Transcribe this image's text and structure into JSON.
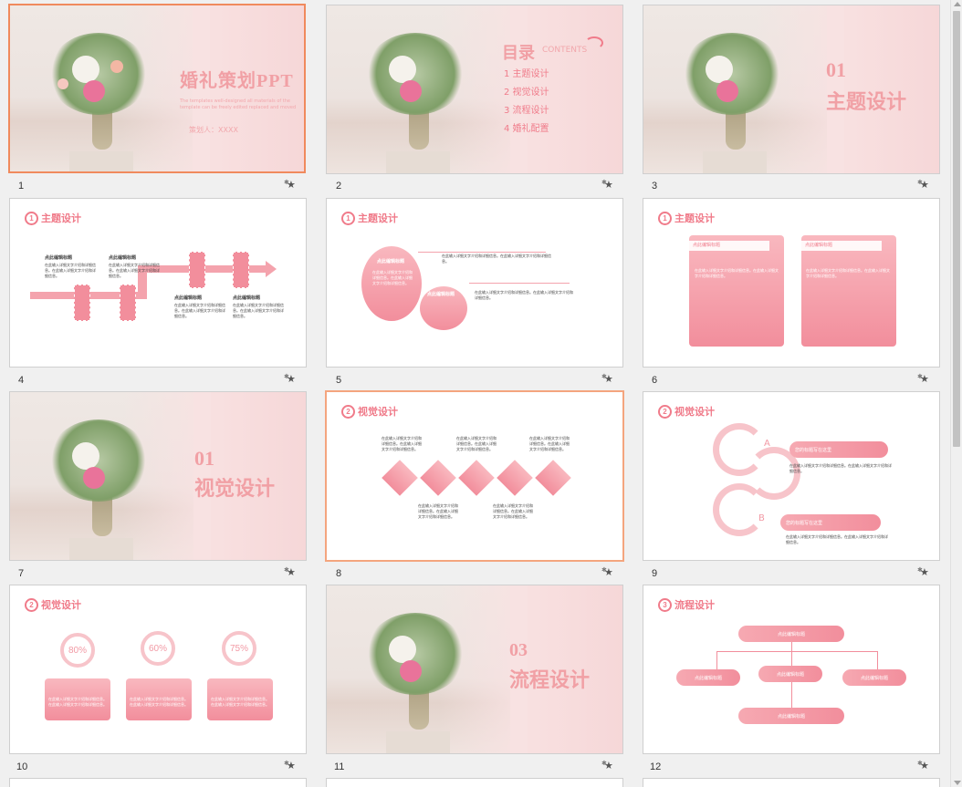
{
  "slides": [
    {
      "num": "1",
      "title": "婚礼策划PPT",
      "subtitle": "The templates well-designed all materials of the template can be freely edited replaced and moved",
      "planner": "策划人：XXXX"
    },
    {
      "num": "2",
      "heading": "目录",
      "heading_en": "CONTENTS",
      "items": [
        "1 主题设计",
        "2 视觉设计",
        "3 流程设计",
        "4 婚礼配置"
      ]
    },
    {
      "num": "3",
      "num_label": "01",
      "title": "主题设计"
    },
    {
      "num": "4",
      "section": "主题设计",
      "labels": [
        "点此编辑标题",
        "点此编辑标题",
        "点此编辑标题",
        "点此编辑标题"
      ]
    },
    {
      "num": "5",
      "section": "主题设计",
      "labels": [
        "点此编辑标题",
        "点此编辑标题"
      ]
    },
    {
      "num": "6",
      "section": "主题设计",
      "labels": [
        "点此编辑标题",
        "点此编辑标题"
      ]
    },
    {
      "num": "7",
      "num_label": "01",
      "title": "视觉设计"
    },
    {
      "num": "8",
      "section": "视觉设计"
    },
    {
      "num": "9",
      "section": "视觉设计",
      "letters": [
        "A",
        "B"
      ],
      "labels": [
        "您的标题写在这里",
        "您的标题写在这里"
      ]
    },
    {
      "num": "10",
      "section": "视觉设计",
      "percents": [
        "80%",
        "60%",
        "75%"
      ]
    },
    {
      "num": "11",
      "num_label": "03",
      "title": "流程设计"
    },
    {
      "num": "12",
      "section": "流程设计",
      "labels": [
        "点此编辑标题",
        "点此编辑标题",
        "点此编辑标题",
        "点此编辑标题",
        "点此编辑标题"
      ]
    }
  ],
  "section_icons": [
    "1",
    "2",
    "3"
  ],
  "placeholder_text": "在此输入详细文字介绍和详细信息。在此输入详细文字介绍和详细信息。",
  "accent_color": "#f07b8a",
  "selected_slide": "1"
}
